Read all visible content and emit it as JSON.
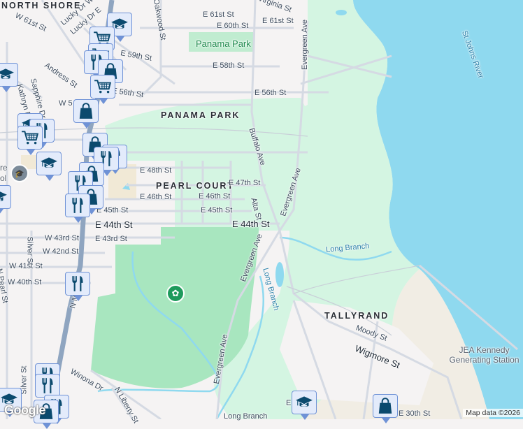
{
  "map": {
    "labels": {
      "north_shore": "NORTH SHORE",
      "w61": "W 61st St",
      "lucky_w": "Lucky Dr W",
      "lucky_e": "Lucky Dr E",
      "oakwood": "Oakwood St",
      "e61a": "E 61st St",
      "e60": "E 60th St",
      "e61b": "E 61st St",
      "virginia": "Virginia St",
      "panama_park_green": "Panama Park",
      "e59": "E 59th St",
      "e58": "E 58th St",
      "andress": "Andress St",
      "s56": "E 56th St",
      "e56": "E 56th St",
      "sapphire": "Sapphire Dr",
      "kathryn": "Kathryn Dr",
      "w5x": "W 5",
      "panama_park_area": "PANAMA PARK",
      "buffalo": "Buffalo Ave",
      "evergreen1": "Evergreen Ave",
      "evergreen2": "Evergreen Ave",
      "evergreen3": "Evergreen Ave",
      "evergreen4": "Evergreen Ave",
      "e48": "E 48th St",
      "pearl_court": "PEARL COURT",
      "e47": "E 47th St",
      "e46a": "E 46th St",
      "e46b": "E 46th St",
      "e45a": "E 45th St",
      "e45b": "E 45th St",
      "alta": "Alta St",
      "e44a": "E 44th St",
      "e44b": "E 44th St",
      "w43": "W 43rd St",
      "e43": "E 43rd St",
      "w42": "W 42nd St",
      "w41": "W 41st St",
      "w40": "W 40th St",
      "silver1": "Silver St",
      "silver2": "Silver St",
      "n_pearl": "N Pearl St",
      "n_main": "N Main St",
      "long_branch1": "Long Branch",
      "long_branch2": "Long Branch",
      "long_branch3": "Long Branch",
      "winona": "Winona Dr",
      "n_liberty": "N Liberty St",
      "tallyrand": "TALLYRAND",
      "moody": "Moody St",
      "wigmore": "Wigmore St",
      "jea": "JEA Kennedy Generating Station",
      "st_johns": "St Johns River",
      "e30": "E 30th St",
      "e_partial": "E",
      "school_partial": "re\nol"
    },
    "attribution": "Map data ©2026",
    "logo": "Google",
    "markers": [
      {
        "type": "school"
      },
      {
        "type": "grocery"
      },
      {
        "type": "grocery"
      },
      {
        "type": "restaurant"
      },
      {
        "type": "shopping"
      },
      {
        "type": "grocery"
      },
      {
        "type": "shopping"
      },
      {
        "type": "school"
      },
      {
        "type": "school"
      },
      {
        "type": "restaurant"
      },
      {
        "type": "grocery"
      },
      {
        "type": "school"
      },
      {
        "type": "shopping"
      },
      {
        "type": "restaurant"
      },
      {
        "type": "restaurant"
      },
      {
        "type": "shopping"
      },
      {
        "type": "restaurant"
      },
      {
        "type": "shopping"
      },
      {
        "type": "restaurant"
      },
      {
        "type": "school"
      },
      {
        "type": "restaurant"
      },
      {
        "type": "restaurant"
      },
      {
        "type": "restaurant"
      },
      {
        "type": "restaurant"
      },
      {
        "type": "school"
      },
      {
        "type": "shopping"
      },
      {
        "type": "school"
      },
      {
        "type": "shopping"
      }
    ],
    "colors": {
      "land": "#f5f3f3",
      "park": "#a8e6bf",
      "park_light": "#d4f5e2",
      "water": "#8fd9ef",
      "industrial": "#f1ede4",
      "road": "#d5dae3",
      "highway": "#8fa5c0",
      "marker_fill": "#e3ebfb",
      "marker_border": "#6f92d6",
      "icon": "#0b4a6e"
    }
  }
}
